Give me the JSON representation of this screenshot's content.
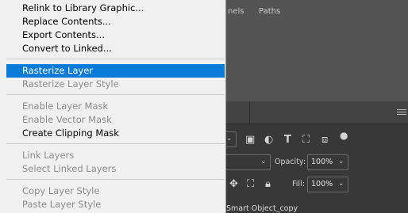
{
  "menu": {
    "group1": [
      {
        "label": "Relink to Library Graphic...",
        "enabled": true
      },
      {
        "label": "Replace Contents...",
        "enabled": true
      },
      {
        "label": "Export Contents...",
        "enabled": true
      },
      {
        "label": "Convert to Linked...",
        "enabled": true
      }
    ],
    "group2": [
      {
        "label": "Rasterize Layer",
        "enabled": true,
        "highlighted": true
      },
      {
        "label": "Rasterize Layer Style",
        "enabled": false
      }
    ],
    "group3": [
      {
        "label": "Enable Layer Mask",
        "enabled": false
      },
      {
        "label": "Enable Vector Mask",
        "enabled": false
      },
      {
        "label": "Create Clipping Mask",
        "enabled": true
      }
    ],
    "group4": [
      {
        "label": "Link Layers",
        "enabled": false
      },
      {
        "label": "Select Linked Layers",
        "enabled": false
      }
    ],
    "group5": [
      {
        "label": "Copy Layer Style",
        "enabled": false
      },
      {
        "label": "Paste Layer Style",
        "enabled": false
      }
    ]
  },
  "panel": {
    "tabs": {
      "channels": "nels",
      "paths": "Paths"
    },
    "opacity_label": "Opacity:",
    "opacity_value": "100%",
    "fill_label": "Fill:",
    "fill_value": "100%",
    "layer_name": "Smart Object_copy"
  },
  "colors": {
    "menu_bg": "#f0f0f0",
    "highlight": "#0a7bd8",
    "panel_bg": "#383838",
    "workspace_bg": "#535353"
  }
}
